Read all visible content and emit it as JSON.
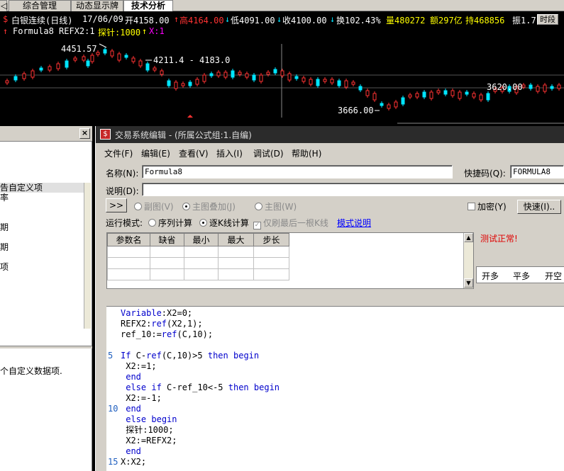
{
  "tabs": [
    "综合管理",
    "动态显示牌",
    "技术分析"
  ],
  "quote": {
    "prefix": "$",
    "name": "白银连续(日线)",
    "date": "17/06/09",
    "open": "开4158.00",
    "high": "高4164.00",
    "low": "低4091.00",
    "close": "收4100.00",
    "turnover": "换102.43%",
    "volume": "量480272",
    "amount": "额297亿",
    "hold": "持468856",
    "amp": "振1.7",
    "time_button": "时段"
  },
  "formula_line": {
    "name": "Formula8 REFX2:1",
    "probe": "探针:1000",
    "x": "X:1"
  },
  "chart_labels": {
    "high_label": "4451.57",
    "range_label": "4211.4 - 4183.0",
    "low_label": "3666.00",
    "right_label": "3620.00"
  },
  "left_panel": {
    "items": [
      "告自定义项",
      "率",
      "",
      "",
      "期",
      "",
      "期",
      "",
      "项"
    ],
    "description": "个自定义数据项."
  },
  "dialog": {
    "title": "交易系统编辑 - (所属公式组:1.自编)",
    "menus": [
      "文件(F)",
      "编辑(E)",
      "查看(V)",
      "插入(I)",
      "调试(D)",
      "帮助(H)"
    ],
    "name_label": "名称(N):",
    "name_value": "Formula8",
    "hotkey_label": "快捷码(Q):",
    "hotkey_value": "FORMULA8",
    "desc_label": "说明(D):",
    "desc_value": "",
    "expand_button": ">>",
    "chart_options": [
      "副图(V)",
      "主图叠加(J)",
      "主图(W)"
    ],
    "encrypt_label": "加密(Y)",
    "quick_button": "快速(I)..",
    "run_mode_label": "运行模式:",
    "run_modes": [
      "序列计算",
      "逐K线计算"
    ],
    "last_bar_label": "仅刷最后一根K线",
    "mode_help_link": "模式说明",
    "param_headers": [
      "参数名",
      "缺省",
      "最小",
      "最大",
      "步长"
    ],
    "status_text": "测试正常!",
    "bottom_tabs": [
      "开多",
      "平多",
      "开空"
    ]
  },
  "code": [
    {
      "n": "",
      "t": "Variable:X2=0;"
    },
    {
      "n": "",
      "t": "REFX2:ref(X2,1);"
    },
    {
      "n": "",
      "t": "ref_10:=ref(C,10);"
    },
    {
      "n": "",
      "t": ""
    },
    {
      "n": "5",
      "t": "If C-ref(C,10)>5 then begin"
    },
    {
      "n": "",
      "t": " X2:=1;"
    },
    {
      "n": "",
      "t": " end"
    },
    {
      "n": "",
      "t": " else if C-ref_10<-5 then begin"
    },
    {
      "n": "",
      "t": " X2:=-1;"
    },
    {
      "n": "10",
      "t": " end"
    },
    {
      "n": "",
      "t": " else begin"
    },
    {
      "n": "",
      "t": " 探针:1000;"
    },
    {
      "n": "",
      "t": " X2:=REFX2;"
    },
    {
      "n": "",
      "t": " end"
    },
    {
      "n": "15",
      "t": "X:X2;"
    }
  ],
  "colors": {
    "up": "#ff3232",
    "down": "#00e5ff",
    "yellow": "#ffff00",
    "magenta": "#ff00ff",
    "keyword": "#0000cc",
    "link": "#0000ff",
    "status": "#e00000"
  }
}
